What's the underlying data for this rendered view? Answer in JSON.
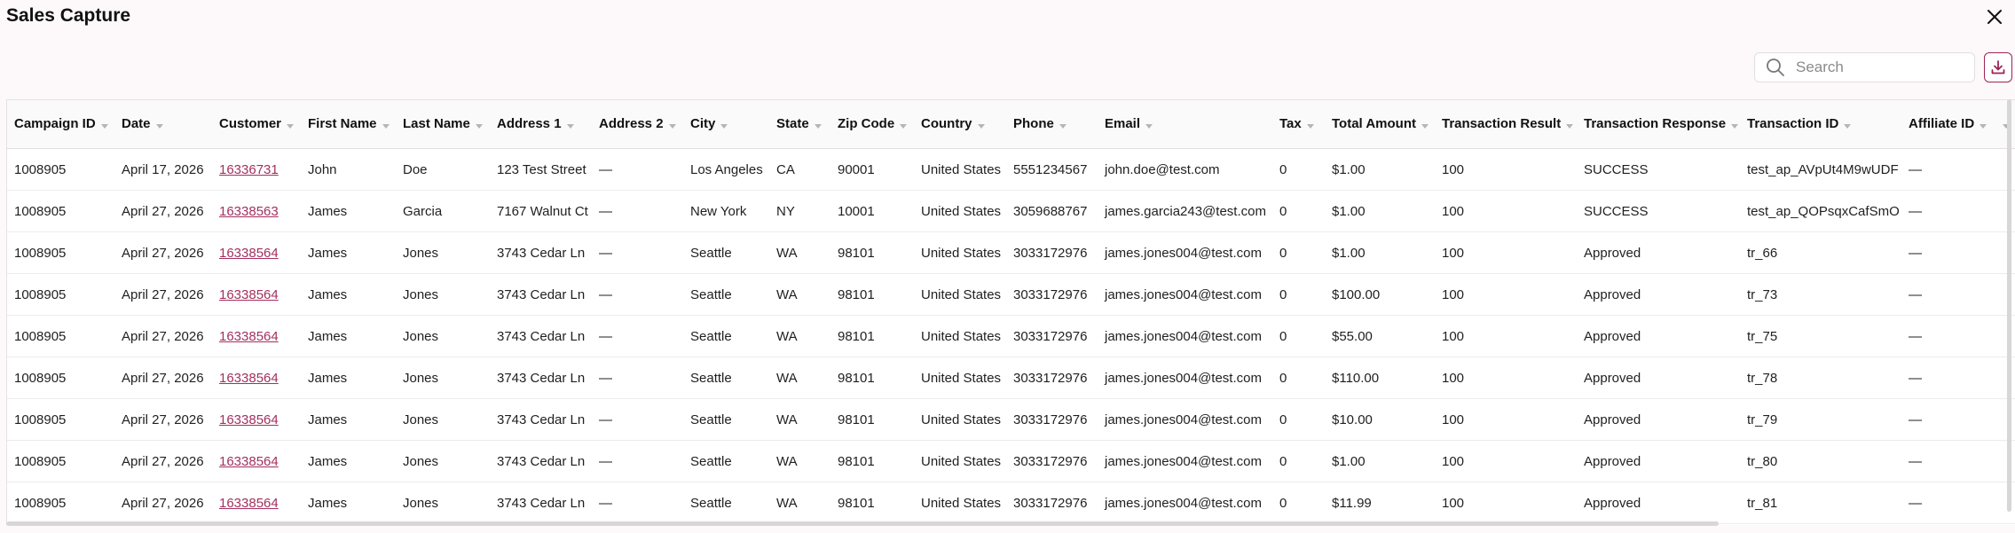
{
  "window": {
    "title": "Sales Capture"
  },
  "icons": {
    "close": "close-icon",
    "search": "search-icon",
    "download": "download-icon",
    "sort": "chevron-down-icon"
  },
  "colors": {
    "accent": "#9b2456",
    "link": "#a3305f"
  },
  "search": {
    "placeholder": "Search",
    "value": ""
  },
  "table": {
    "columns": [
      "Campaign ID",
      "Date",
      "Customer",
      "First Name",
      "Last Name",
      "Address 1",
      "Address 2",
      "City",
      "State",
      "Zip Code",
      "Country",
      "Phone",
      "Email",
      "Tax",
      "Total Amount",
      "Transaction Result",
      "Transaction Response",
      "Transaction ID",
      "Affiliate ID",
      ""
    ],
    "rows": [
      [
        "1008905",
        "April 17, 2026",
        "16336731",
        "John",
        "Doe",
        "123 Test Street",
        "—",
        "Los Angeles",
        "CA",
        "90001",
        "United States",
        "5551234567",
        "john.doe@test.com",
        "0",
        "$1.00",
        "100",
        "SUCCESS",
        "test_ap_AVpUt4M9wUDF",
        "—",
        ""
      ],
      [
        "1008905",
        "April 27, 2026",
        "16338563",
        "James",
        "Garcia",
        "7167 Walnut Ct",
        "—",
        "New York",
        "NY",
        "10001",
        "United States",
        "3059688767",
        "james.garcia243@test.com",
        "0",
        "$1.00",
        "100",
        "SUCCESS",
        "test_ap_QOPsqxCafSmO",
        "—",
        ""
      ],
      [
        "1008905",
        "April 27, 2026",
        "16338564",
        "James",
        "Jones",
        "3743 Cedar Ln",
        "—",
        "Seattle",
        "WA",
        "98101",
        "United States",
        "3033172976",
        "james.jones004@test.com",
        "0",
        "$1.00",
        "100",
        "Approved",
        "tr_66",
        "—",
        ""
      ],
      [
        "1008905",
        "April 27, 2026",
        "16338564",
        "James",
        "Jones",
        "3743 Cedar Ln",
        "—",
        "Seattle",
        "WA",
        "98101",
        "United States",
        "3033172976",
        "james.jones004@test.com",
        "0",
        "$100.00",
        "100",
        "Approved",
        "tr_73",
        "—",
        ""
      ],
      [
        "1008905",
        "April 27, 2026",
        "16338564",
        "James",
        "Jones",
        "3743 Cedar Ln",
        "—",
        "Seattle",
        "WA",
        "98101",
        "United States",
        "3033172976",
        "james.jones004@test.com",
        "0",
        "$55.00",
        "100",
        "Approved",
        "tr_75",
        "—",
        ""
      ],
      [
        "1008905",
        "April 27, 2026",
        "16338564",
        "James",
        "Jones",
        "3743 Cedar Ln",
        "—",
        "Seattle",
        "WA",
        "98101",
        "United States",
        "3033172976",
        "james.jones004@test.com",
        "0",
        "$110.00",
        "100",
        "Approved",
        "tr_78",
        "—",
        ""
      ],
      [
        "1008905",
        "April 27, 2026",
        "16338564",
        "James",
        "Jones",
        "3743 Cedar Ln",
        "—",
        "Seattle",
        "WA",
        "98101",
        "United States",
        "3033172976",
        "james.jones004@test.com",
        "0",
        "$10.00",
        "100",
        "Approved",
        "tr_79",
        "—",
        ""
      ],
      [
        "1008905",
        "April 27, 2026",
        "16338564",
        "James",
        "Jones",
        "3743 Cedar Ln",
        "—",
        "Seattle",
        "WA",
        "98101",
        "United States",
        "3033172976",
        "james.jones004@test.com",
        "0",
        "$1.00",
        "100",
        "Approved",
        "tr_80",
        "—",
        ""
      ],
      [
        "1008905",
        "April 27, 2026",
        "16338564",
        "James",
        "Jones",
        "3743 Cedar Ln",
        "—",
        "Seattle",
        "WA",
        "98101",
        "United States",
        "3033172976",
        "james.jones004@test.com",
        "0",
        "$11.99",
        "100",
        "Approved",
        "tr_81",
        "—",
        ""
      ]
    ]
  }
}
